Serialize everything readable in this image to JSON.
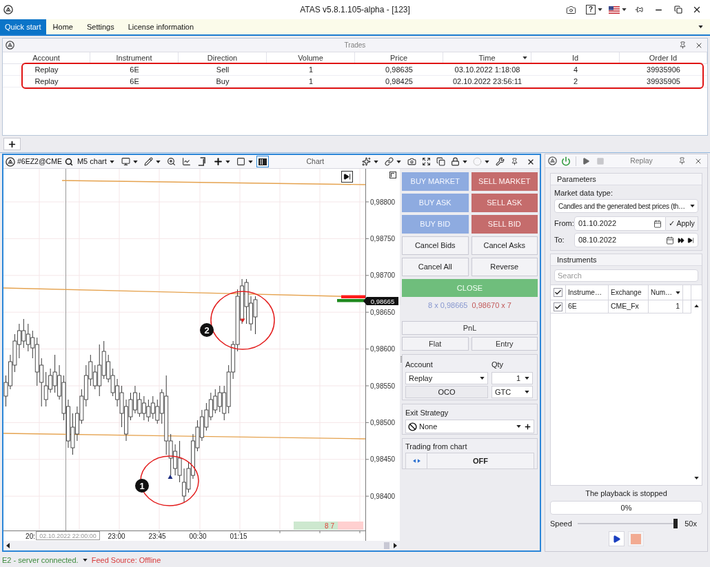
{
  "window": {
    "title": "ATAS v5.8.1.105-alpha - [123]",
    "help_button": "?"
  },
  "menu": [
    {
      "label": "Quick start",
      "selected": true
    },
    {
      "label": "Home",
      "selected": false
    },
    {
      "label": "Settings",
      "selected": false
    },
    {
      "label": "License information",
      "selected": false
    }
  ],
  "trades": {
    "title": "Trades",
    "highlighted": true,
    "columns": [
      {
        "label": "Account",
        "sorted": false
      },
      {
        "label": "Instrument",
        "sorted": false
      },
      {
        "label": "Direction",
        "sorted": false
      },
      {
        "label": "Volume",
        "sorted": false
      },
      {
        "label": "Price",
        "sorted": false
      },
      {
        "label": "Time",
        "sorted": true
      },
      {
        "label": "Id",
        "sorted": false
      },
      {
        "label": "Order Id",
        "sorted": false
      }
    ],
    "rows": [
      [
        "Replay",
        "6E",
        "Sell",
        "1",
        "0,98635",
        "03.10.2022 1:18:08",
        "4",
        "39935906"
      ],
      [
        "Replay",
        "6E",
        "Buy",
        "1",
        "0,98425",
        "02.10.2022 23:56:11",
        "2",
        "39935905"
      ]
    ]
  },
  "chart": {
    "symbol": "#6EZ2@CME",
    "timeframe": "M5 chart",
    "title": "Chart",
    "view_toggle_on": true,
    "price_ticks": [
      "0,98800",
      "0,98750",
      "0,98700",
      "0,98650",
      "0,98600",
      "0,98550",
      "0,98500",
      "0,98450",
      "0,98400"
    ],
    "last_price": "0,98665",
    "time_labels": [
      "20:",
      "23:00",
      "23:45",
      "00:30",
      "01:15"
    ],
    "crosshair_time": "02.10.2022 22:00:00",
    "volume": "8 7",
    "markers": [
      {
        "label": "1"
      },
      {
        "label": "2"
      }
    ]
  },
  "trading": {
    "order_buttons": [
      {
        "label": "BUY MARKET",
        "kind": "buy"
      },
      {
        "label": "SELL MARKET",
        "kind": "sell"
      },
      {
        "label": "BUY ASK",
        "kind": "buy"
      },
      {
        "label": "SELL ASK",
        "kind": "sell"
      },
      {
        "label": "BUY BID",
        "kind": "buy"
      },
      {
        "label": "SELL BID",
        "kind": "sell"
      },
      {
        "label": "Cancel Bids",
        "kind": "plain"
      },
      {
        "label": "Cancel Asks",
        "kind": "plain"
      },
      {
        "label": "Cancel All",
        "kind": "plain"
      },
      {
        "label": "Reverse",
        "kind": "plain"
      }
    ],
    "close_button": "CLOSE",
    "bid_quote": "8 x 0,98665",
    "ask_quote": "0,98670 x 7",
    "pnl_button": "PnL",
    "pnl_modes": [
      "Flat",
      "Entry"
    ],
    "account_label": "Account",
    "account_value": "Replay",
    "qty_label": "Qty",
    "qty_value": "1",
    "oco_button": "OCO",
    "time_in_force": "GTC",
    "exit_strategy_label": "Exit Strategy",
    "exit_strategy_value": "None",
    "chart_trading_label": "Trading from chart",
    "chart_trading_state": "OFF"
  },
  "replay": {
    "title": "Replay",
    "parameters": {
      "title": "Parameters",
      "market_data_label": "Market data type:",
      "market_data_value": "Candles and the generated best prices (th…",
      "from_label": "From:",
      "from_value": "01.10.2022",
      "apply_button": "✓ Apply",
      "to_label": "To:",
      "to_value": "08.10.2022"
    },
    "instruments": {
      "title": "Instruments",
      "search_placeholder": "Search",
      "all_checked": true,
      "columns": [
        {
          "label": "Instrume…",
          "sorted": false
        },
        {
          "label": "Exchange",
          "sorted": false
        },
        {
          "label": "Num…",
          "sorted": true
        }
      ],
      "rows": [
        {
          "checked": true,
          "cells": [
            "6E",
            "CME_Fx",
            "1"
          ]
        }
      ]
    },
    "status": "The playback is stopped",
    "progress": {
      "reading": "0%"
    },
    "speed": {
      "label": "Speed",
      "level": 1,
      "reading": "50x"
    }
  },
  "status_bar": {
    "connection": "E2 - server connected.",
    "feed": "Feed Source: Offline"
  }
}
